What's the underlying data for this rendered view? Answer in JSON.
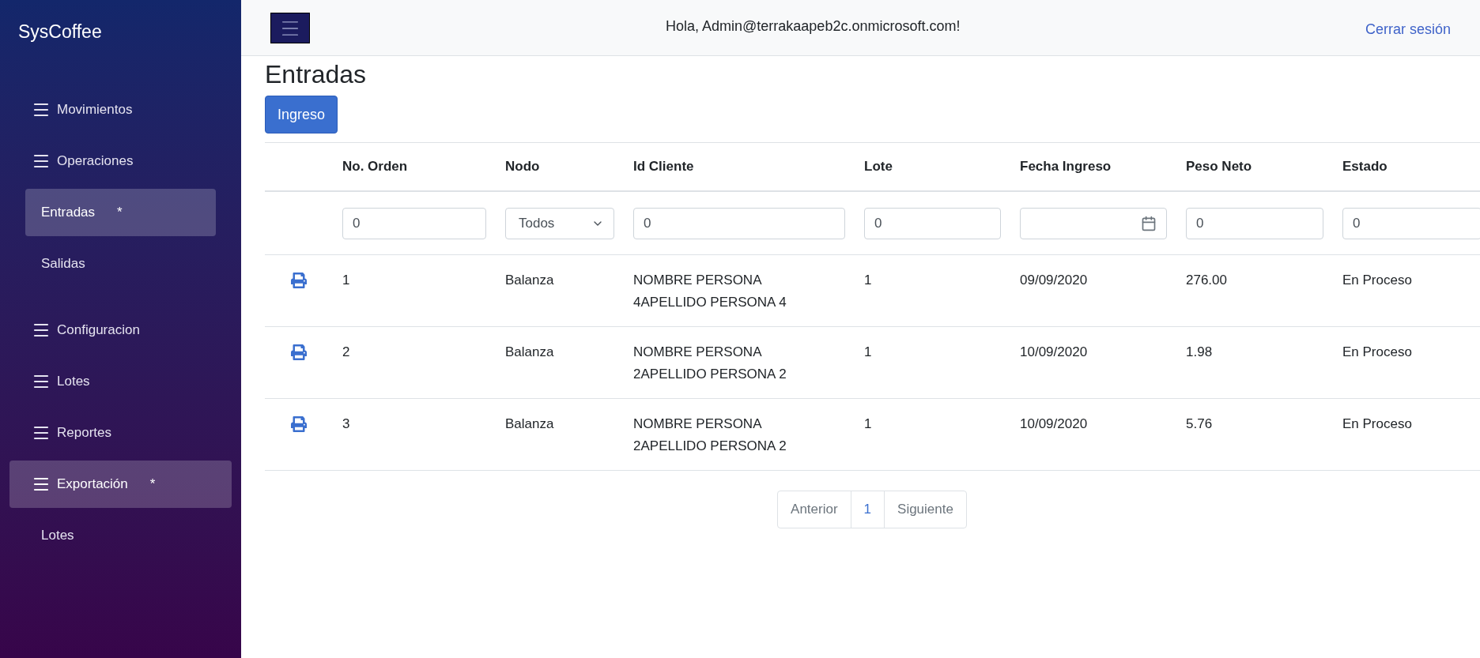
{
  "sidebar": {
    "brand": "SysCoffee",
    "items": [
      {
        "label": "Movimientos",
        "selected": false
      },
      {
        "label": "Operaciones",
        "selected": false,
        "children": [
          {
            "label": "Entradas",
            "selected": true,
            "mark": "*"
          },
          {
            "label": "Salidas",
            "selected": false
          }
        ]
      },
      {
        "label": "Configuracion",
        "selected": false
      },
      {
        "label": "Lotes",
        "selected": false
      },
      {
        "label": "Reportes",
        "selected": false
      },
      {
        "label": "Exportación",
        "selected": true,
        "mark": "*",
        "children": [
          {
            "label": "Lotes",
            "selected": false
          }
        ]
      }
    ]
  },
  "header": {
    "greeting": "Hola, Admin@terrakaapeb2c.onmicrosoft.com!",
    "logout": "Cerrar sesión"
  },
  "page": {
    "title": "Entradas",
    "primary_button": "Ingreso"
  },
  "table": {
    "columns": [
      "No. Orden",
      "Nodo",
      "Id Cliente",
      "Lote",
      "Fecha Ingreso",
      "Peso Neto",
      "Estado"
    ],
    "filters": [
      {
        "kind": "text",
        "value": "0"
      },
      {
        "kind": "select",
        "value": "Todos"
      },
      {
        "kind": "text",
        "value": "0"
      },
      {
        "kind": "text",
        "value": "0"
      },
      {
        "kind": "date"
      },
      {
        "kind": "text",
        "value": "0"
      },
      {
        "kind": "text",
        "value": "0"
      }
    ],
    "rows": [
      [
        "1",
        "Balanza",
        "NOMBRE PERSONA 4APELLIDO PERSONA 4",
        "1",
        "09/09/2020",
        "276.00",
        "En Proceso"
      ],
      [
        "2",
        "Balanza",
        "NOMBRE PERSONA 2APELLIDO PERSONA 2",
        "1",
        "10/09/2020",
        "1.98",
        "En Proceso"
      ],
      [
        "3",
        "Balanza",
        "NOMBRE PERSONA 2APELLIDO PERSONA 2",
        "1",
        "10/09/2020",
        "5.76",
        "En Proceso"
      ]
    ]
  },
  "pagination": {
    "previous": "Anterior",
    "pages": [
      {
        "label": "1",
        "selected": true
      }
    ],
    "next": "Siguiente"
  }
}
